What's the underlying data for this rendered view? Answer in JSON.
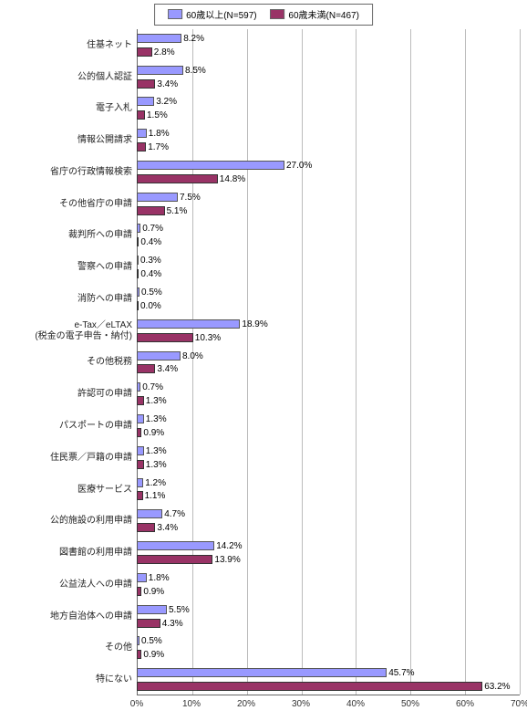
{
  "chart_data": {
    "type": "bar",
    "title": "",
    "xlabel": "",
    "ylabel": "",
    "xlim": [
      0,
      70
    ],
    "xticks": [
      "0%",
      "10%",
      "20%",
      "30%",
      "40%",
      "50%",
      "60%",
      "70%"
    ],
    "legend": {
      "series_a": "60歳以上(N=597)",
      "series_b": "60歳未満(N=467)"
    },
    "categories": [
      {
        "label": "住基ネット",
        "a": 8.2,
        "b": 2.8
      },
      {
        "label": "公的個人認証",
        "a": 8.5,
        "b": 3.4
      },
      {
        "label": "電子入札",
        "a": 3.2,
        "b": 1.5
      },
      {
        "label": "情報公開請求",
        "a": 1.8,
        "b": 1.7
      },
      {
        "label": "省庁の行政情報検索",
        "a": 27.0,
        "b": 14.8
      },
      {
        "label": "その他省庁の申請",
        "a": 7.5,
        "b": 5.1
      },
      {
        "label": "裁判所への申請",
        "a": 0.7,
        "b": 0.4
      },
      {
        "label": "警察への申請",
        "a": 0.3,
        "b": 0.4
      },
      {
        "label": "消防への申請",
        "a": 0.5,
        "b": 0.0
      },
      {
        "label": "e-Tax／eLTAX\n(税金の電子申告・納付)",
        "a": 18.9,
        "b": 10.3
      },
      {
        "label": "その他税務",
        "a": 8.0,
        "b": 3.4
      },
      {
        "label": "許認可の申請",
        "a": 0.7,
        "b": 1.3
      },
      {
        "label": "パスポートの申請",
        "a": 1.3,
        "b": 0.9
      },
      {
        "label": "住民票／戸籍の申請",
        "a": 1.3,
        "b": 1.3
      },
      {
        "label": "医療サービス",
        "a": 1.2,
        "b": 1.1
      },
      {
        "label": "公的施設の利用申請",
        "a": 4.7,
        "b": 3.4
      },
      {
        "label": "図書館の利用申請",
        "a": 14.2,
        "b": 13.9
      },
      {
        "label": "公益法人への申請",
        "a": 1.8,
        "b": 0.9
      },
      {
        "label": "地方自治体への申請",
        "a": 5.5,
        "b": 4.3
      },
      {
        "label": "その他",
        "a": 0.5,
        "b": 0.9
      },
      {
        "label": "特にない",
        "a": 45.7,
        "b": 63.2
      }
    ]
  }
}
